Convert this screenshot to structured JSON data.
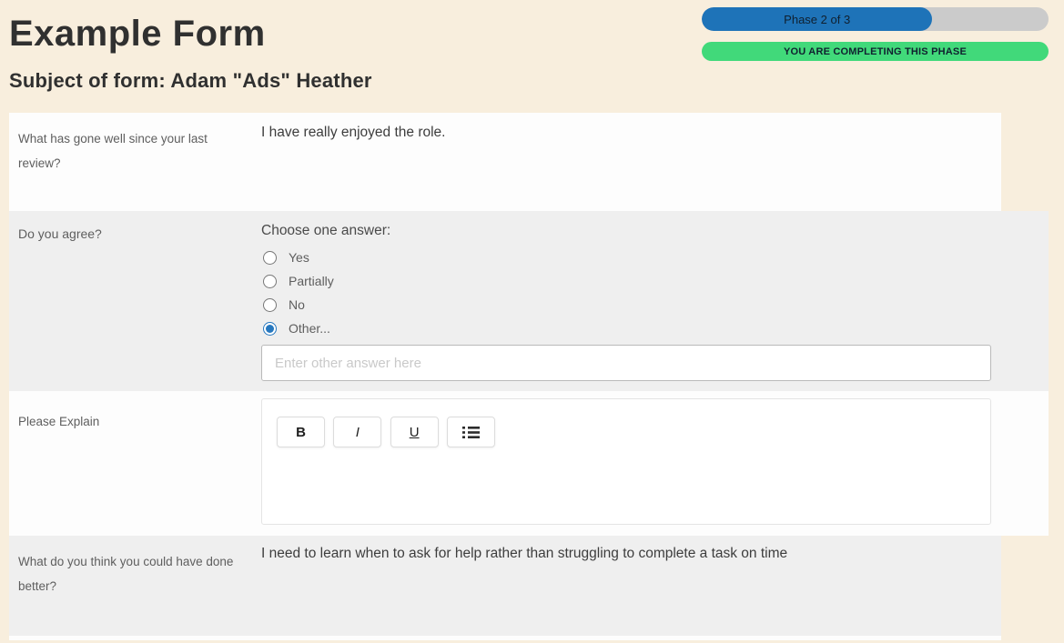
{
  "colors": {
    "cream_background": "#f8eedd",
    "row_white": "#fdfdfd",
    "row_gray": "#efefef",
    "progress_blue": "#1e73b8",
    "progress_track_gray": "#cbcbcb",
    "status_green": "#41d97a",
    "radio_accent": "#2778bf"
  },
  "header": {
    "title": "Example Form",
    "subject": "Subject of form: Adam \"Ads\" Heather",
    "progress": {
      "phase_label": "Phase 2 of 3",
      "percent": 66.5,
      "status_label": "YOU ARE COMPLETING THIS PHASE"
    }
  },
  "form": {
    "rows": [
      {
        "question": "What has gone well since your last review?",
        "answer": "I have really enjoyed the role."
      },
      {
        "question": "Do you agree?",
        "prompt": "Choose one answer:",
        "options": [
          "Yes",
          "Partially",
          "No",
          "Other..."
        ],
        "selected_index": 3,
        "other_placeholder": "Enter other answer here",
        "other_value": ""
      },
      {
        "question": "Please Explain",
        "toolbar": {
          "bold": "B",
          "italic": "I",
          "underline": "U",
          "list": "bullet-list"
        },
        "content": ""
      },
      {
        "question": "What do you think you could have done better?",
        "answer": "I need to learn when to ask for help rather than struggling to complete a task on time"
      }
    ]
  }
}
